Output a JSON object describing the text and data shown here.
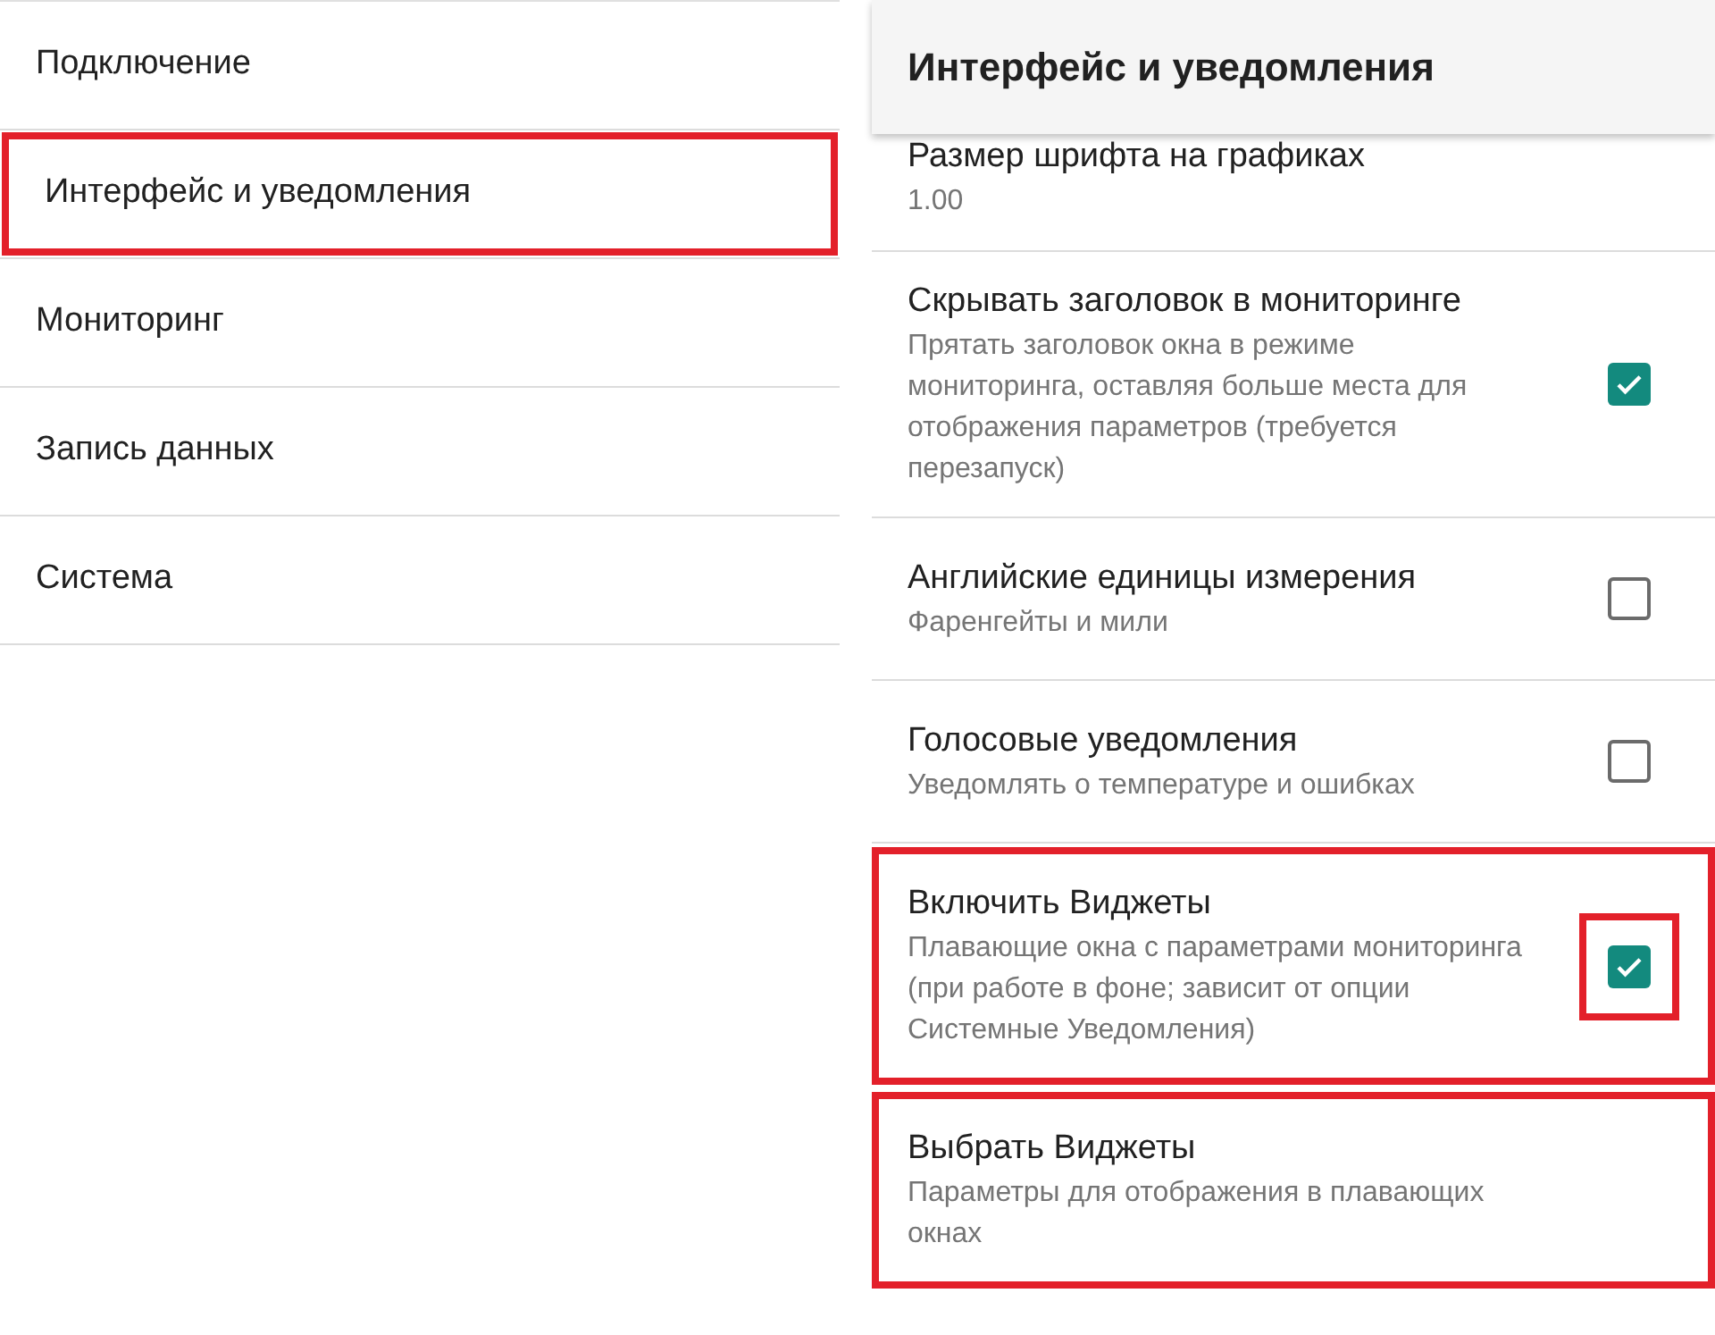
{
  "menu": {
    "items": [
      {
        "label": "Подключение",
        "highlighted": false
      },
      {
        "label": "Интерфейс и уведомления",
        "highlighted": true
      },
      {
        "label": "Мониторинг",
        "highlighted": false
      },
      {
        "label": "Запись данных",
        "highlighted": false
      },
      {
        "label": "Система",
        "highlighted": false
      }
    ]
  },
  "settings": {
    "title": "Интерфейс и уведомления",
    "items": [
      {
        "kind": "value",
        "title": "Размер шрифта на графиках",
        "value": "1.00",
        "highlighted": false
      },
      {
        "kind": "checkbox",
        "title": "Скрывать заголовок в мониторинге",
        "description": "Прятать заголовок окна в режиме мониторинга, оставляя больше места для отображения параметров (требуется перезапуск)",
        "checked": true,
        "highlighted": false,
        "checkbox_highlighted": false
      },
      {
        "kind": "checkbox",
        "title": "Английские единицы измерения",
        "description": "Фаренгейты и мили",
        "checked": false,
        "highlighted": false,
        "checkbox_highlighted": false
      },
      {
        "kind": "checkbox",
        "title": "Голосовые уведомления",
        "description": "Уведомлять о температуре и ошибках",
        "checked": false,
        "highlighted": false,
        "checkbox_highlighted": false
      },
      {
        "kind": "checkbox",
        "title": "Включить Виджеты",
        "description": "Плавающие окна с параметрами мониторинга (при работе в фоне; зависит от опции Системные Уведомления)",
        "checked": true,
        "highlighted": true,
        "checkbox_highlighted": true
      },
      {
        "kind": "link",
        "title": "Выбрать Виджеты",
        "description": "Параметры для отображения в плавающих окнах",
        "highlighted": true
      }
    ]
  }
}
